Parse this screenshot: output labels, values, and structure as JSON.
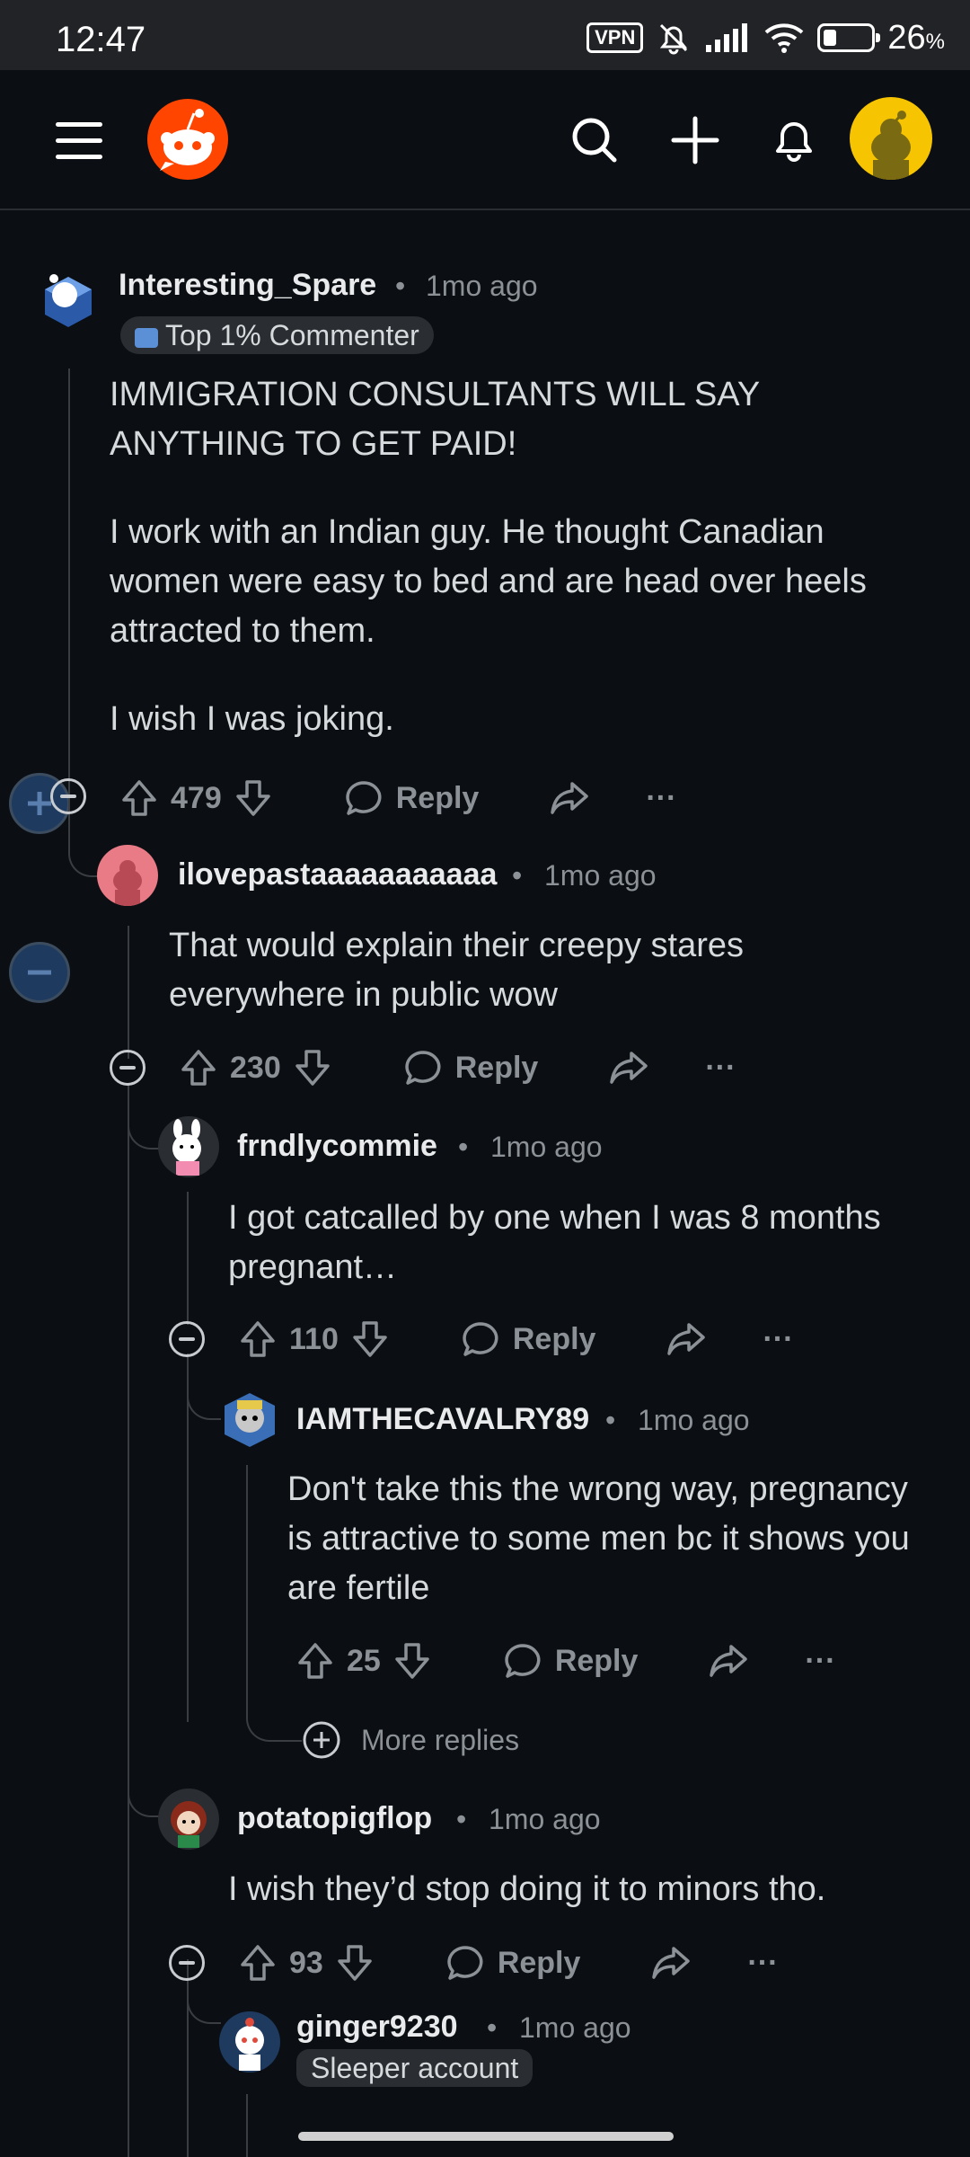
{
  "status_bar": {
    "time": "12:47",
    "vpn": "VPN",
    "battery_pct": "26",
    "battery_unit": "%"
  },
  "app_bar": {
    "icons": [
      "menu-icon",
      "reddit-logo",
      "search-icon",
      "plus-icon",
      "bell-icon",
      "profile-avatar"
    ]
  },
  "comments": [
    {
      "user": "Interesting_Spare",
      "time": "1mo ago",
      "flair": "Top 1% Commenter",
      "paragraphs": [
        "IMMIGRATION CONSULTANTS WILL SAY ANYTHING TO GET PAID!",
        "I work with an Indian guy. He thought Canadian women were easy to bed and are head over heels attracted to them.",
        "I wish I was joking."
      ],
      "votes": "479",
      "reply": "Reply"
    },
    {
      "user": "ilovepastaaaaaaaaaaa",
      "time": "1mo ago",
      "paragraphs": [
        "That would explain their creepy stares everywhere in public wow"
      ],
      "votes": "230",
      "reply": "Reply"
    },
    {
      "user": "frndlycommie",
      "time": "1mo ago",
      "paragraphs": [
        "I got catcalled by one when I was 8 months pregnant…"
      ],
      "votes": "110",
      "reply": "Reply"
    },
    {
      "user": "IAMTHECAVALRY89",
      "time": "1mo ago",
      "paragraphs": [
        "Don't take this the wrong way, pregnancy is attractive to some men bc it shows you are fertile"
      ],
      "votes": "25",
      "reply": "Reply"
    },
    {
      "user": "potatopigflop",
      "time": "1mo ago",
      "paragraphs": [
        "I wish they’d stop doing it to minors tho."
      ],
      "votes": "93",
      "reply": "Reply"
    },
    {
      "user": "ginger9230",
      "time": "1mo ago",
      "flair": "Sleeper account",
      "paragraphs": [],
      "votes": "",
      "reply": ""
    }
  ],
  "more_replies": "More replies",
  "separator": "•",
  "more_glyph": "···",
  "colors": {
    "background": "#0b0e12",
    "accent": "#ff4500",
    "collapse_fab": "#1e3a5f"
  }
}
